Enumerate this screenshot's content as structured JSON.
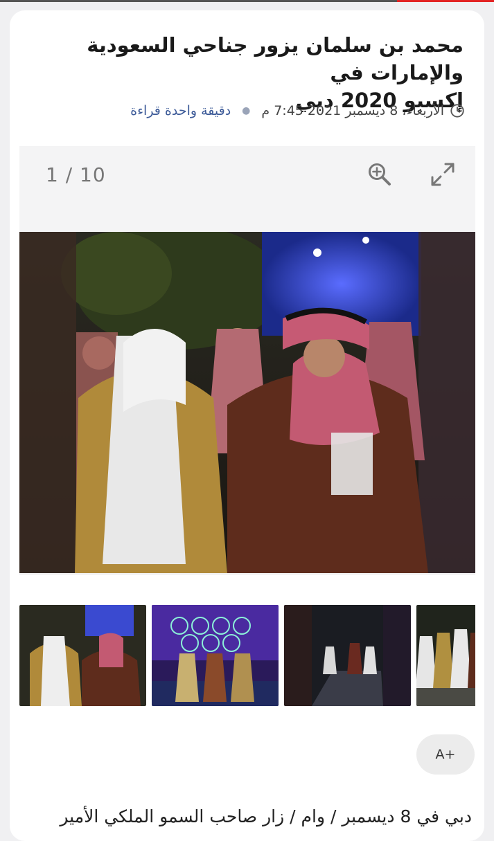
{
  "article": {
    "title_line1": "محمد بن سلمان يزور جناحي السعودية والإمارات في",
    "title_line2": "إكسبو 2020 دبي",
    "date": "الأربعاء، 8 ديسمبر 2021 7:45 م",
    "reading_time": "دقيقة واحدة قراءة",
    "body_first_line": "دبي في 8 ديسمبر / وام / زار صاحب السمو الملكي الأمير"
  },
  "gallery": {
    "counter": "1 / 10",
    "current": 1,
    "total": 10,
    "zoom_icon": "zoom-in-icon",
    "fullscreen_icon": "fullscreen-icon"
  },
  "font_size_button": {
    "label": "A+"
  },
  "colors": {
    "page_bg": "#f0f0f2",
    "card_bg": "#ffffff",
    "accent_red": "#e32424",
    "link_blue": "#3c5a98"
  }
}
